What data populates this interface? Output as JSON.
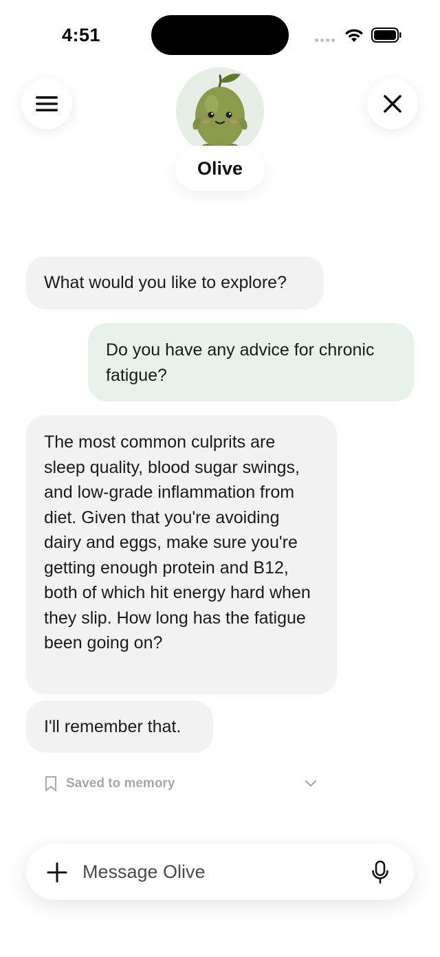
{
  "status_bar": {
    "time": "4:51",
    "icons": [
      "signal-dots-icon",
      "wifi-icon",
      "battery-icon"
    ]
  },
  "header": {
    "menu_icon": "hamburger-menu-icon",
    "close_icon": "close-icon",
    "avatar": "olive-character-avatar",
    "assistant_name": "Olive"
  },
  "messages": [
    {
      "role": "assistant",
      "text": "What would you like to explore?"
    },
    {
      "role": "user",
      "text": "Do you have any advice for chronic fatigue?"
    },
    {
      "role": "assistant",
      "text": "The most common culprits are sleep quality, blood sugar swings, and low-grade inflammation from diet. Given that you're avoiding dairy and eggs, make sure you're getting enough protein and B12, both of which hit energy hard when they slip. How long has the fatigue been going on?"
    },
    {
      "role": "assistant",
      "text": "I'll remember that."
    }
  ],
  "memory": {
    "label": "Saved to memory",
    "icon": "bookmark-icon",
    "expand_icon": "chevron-down-icon"
  },
  "composer": {
    "placeholder": "Message Olive",
    "add_icon": "plus-icon",
    "mic_icon": "microphone-icon"
  },
  "colors": {
    "bot_bubble": "#f2f2f2",
    "user_bubble": "#e9f2ea",
    "avatar_bg": "#e6eee6",
    "olive": "#8a9a4a"
  }
}
